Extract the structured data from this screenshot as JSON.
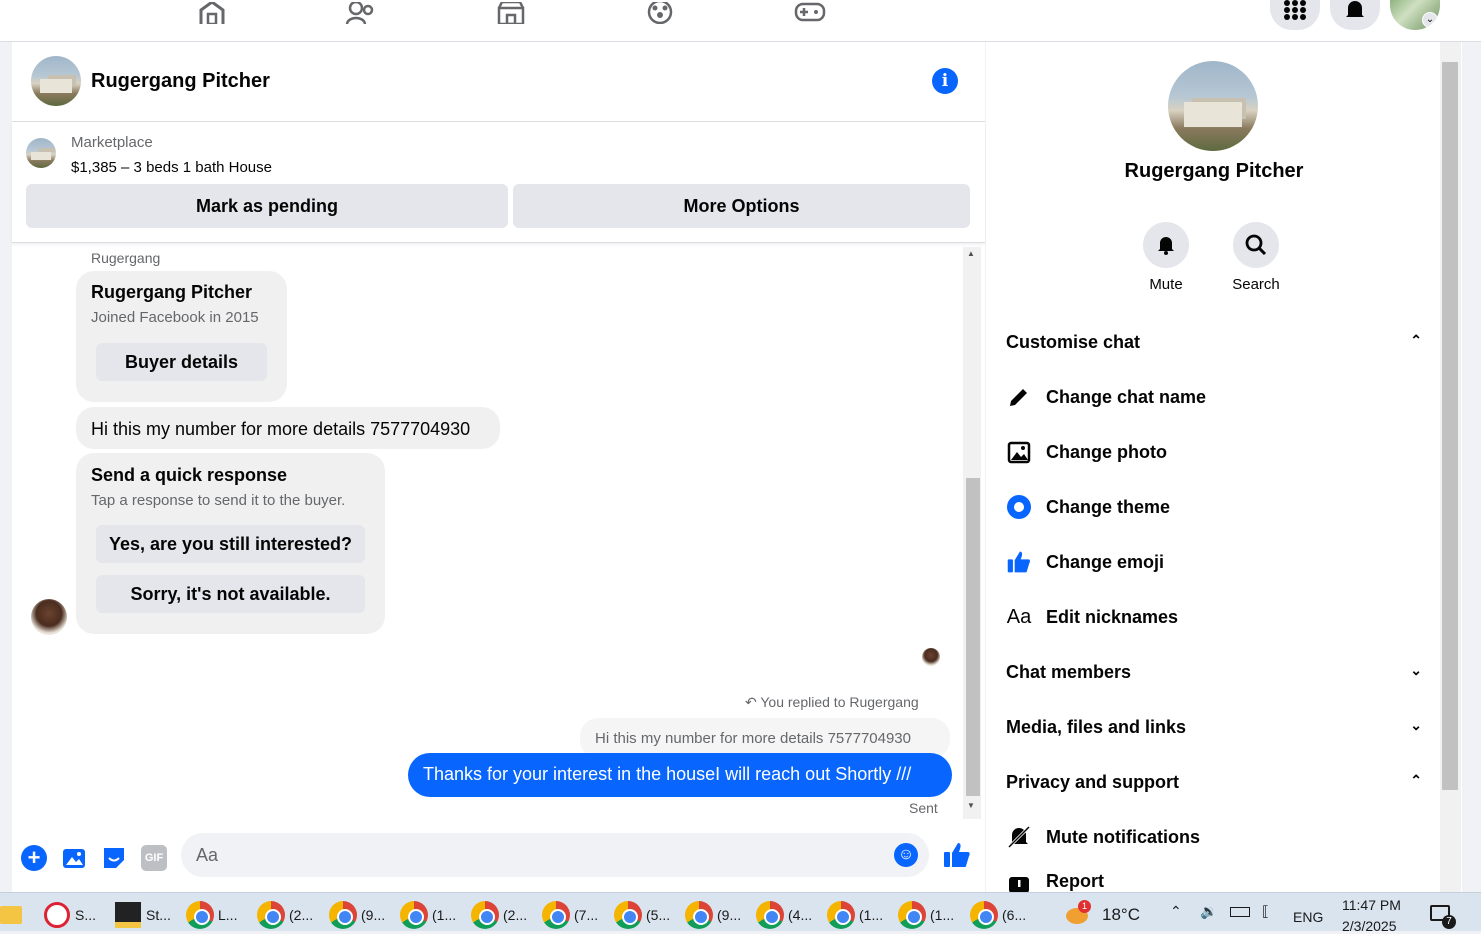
{
  "chat": {
    "title": "Rugergang Pitcher",
    "marketplace_label": "Marketplace",
    "listing_title": "$1,385 – 3 beds 1 bath House",
    "mark_pending": "Mark as pending",
    "more_options": "More Options"
  },
  "messages": {
    "sender_name": "Rugergang",
    "card_name": "Rugergang Pitcher",
    "card_joined": "Joined Facebook in 2015",
    "buyer_details": "Buyer details",
    "incoming_text": "Hi this my number for more details 7577704930",
    "quick_title": "Send a quick response",
    "quick_sub": "Tap a response to send it to the buyer.",
    "quick_option_1": "Yes, are you still interested?",
    "quick_option_2": "Sorry, it's not available.",
    "reply_note": "You replied to Rugergang",
    "quoted_text": "Hi this my number for more details 7577704930",
    "outgoing_text": "Thanks for your interest in the houseI will reach out Shortly ///",
    "status": "Sent"
  },
  "composer": {
    "placeholder": "Aa",
    "gif_label": "GIF"
  },
  "profile": {
    "name": "Rugergang Pitcher",
    "mute_label": "Mute",
    "search_label": "Search",
    "customise_chat": "Customise chat",
    "change_chat_name": "Change chat name",
    "change_photo": "Change photo",
    "change_theme": "Change theme",
    "change_emoji": "Change emoji",
    "edit_nicknames": "Edit nicknames",
    "nickname_icon_text": "Aa",
    "chat_members": "Chat members",
    "media_files_links": "Media, files and links",
    "privacy_support": "Privacy and support",
    "mute_notifications": "Mute notifications",
    "report": "Report"
  },
  "taskbar": {
    "apps": [
      "S...",
      "St...",
      "L...",
      "(2...",
      "(9...",
      "(1...",
      "(2...",
      "(7...",
      "(5...",
      "(9...",
      "(4...",
      "(1...",
      "(1...",
      "(6..."
    ],
    "weather": "18°C",
    "weather_badge": "1",
    "language": "ENG",
    "time": "11:47 PM",
    "date": "2/3/2025",
    "notification_count": "7"
  },
  "colors": {
    "accent": "#0866ff",
    "bubble_incoming": "#f0f0f0",
    "button_gray": "#e4e6eb"
  }
}
